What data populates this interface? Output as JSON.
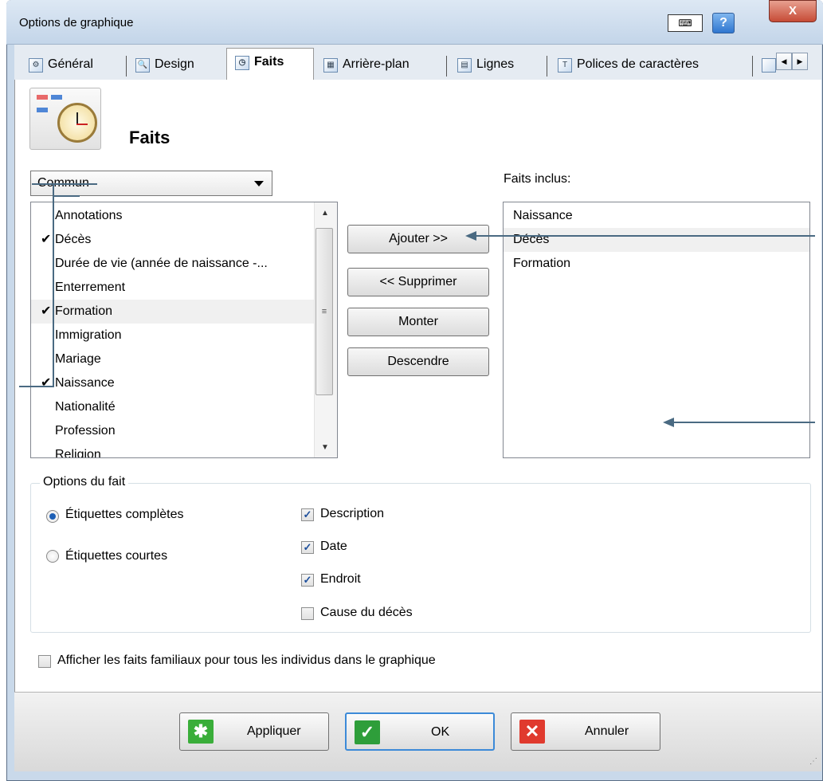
{
  "window": {
    "title": "Options de graphique",
    "help_label": "?",
    "close_label": "X",
    "keyboard_icon": "keyboard-icon"
  },
  "tabs": [
    {
      "label": "Général",
      "icon": "gear-doc-icon"
    },
    {
      "label": "Design",
      "icon": "magnifier-doc-icon"
    },
    {
      "label": "Faits",
      "icon": "clock-doc-icon",
      "active": true
    },
    {
      "label": "Arrière-plan",
      "icon": "background-icon"
    },
    {
      "label": "Lignes",
      "icon": "lines-icon"
    },
    {
      "label": "Polices de caractères",
      "icon": "font-icon"
    }
  ],
  "page": {
    "heading": "Faits",
    "icon": "facts-clock-icon"
  },
  "category": {
    "selected": "Commun"
  },
  "available_facts": [
    {
      "label": "Annotations",
      "checked": false
    },
    {
      "label": "Décès",
      "checked": true
    },
    {
      "label": "Durée de vie (année de naissance -...",
      "checked": false
    },
    {
      "label": "Enterrement",
      "checked": false
    },
    {
      "label": "Formation",
      "checked": true,
      "highlighted": true
    },
    {
      "label": "Immigration",
      "checked": false
    },
    {
      "label": "Mariage",
      "checked": false
    },
    {
      "label": "Naissance",
      "checked": true
    },
    {
      "label": "Nationalité",
      "checked": false
    },
    {
      "label": "Profession",
      "checked": false
    },
    {
      "label": "Religion",
      "checked": false
    }
  ],
  "actions": {
    "add": "Ajouter >>",
    "remove": "<< Supprimer",
    "up": "Monter",
    "down": "Descendre"
  },
  "included": {
    "label": "Faits inclus:",
    "items": [
      "Naissance",
      "Décès",
      "Formation"
    ],
    "highlighted_index": 1
  },
  "fact_options": {
    "legend": "Options du fait",
    "radios": [
      {
        "label": "Étiquettes complètes",
        "selected": true
      },
      {
        "label": "Étiquettes courtes",
        "selected": false
      }
    ],
    "checkboxes": [
      {
        "label": "Description",
        "checked": true
      },
      {
        "label": "Date",
        "checked": true
      },
      {
        "label": "Endroit",
        "checked": true
      },
      {
        "label": "Cause du décès",
        "checked": false
      }
    ]
  },
  "family_facts": {
    "label": "Afficher les faits familiaux pour tous les individus dans le graphique",
    "checked": false
  },
  "footer": {
    "apply": "Appliquer",
    "ok": "OK",
    "cancel": "Annuler"
  },
  "colors": {
    "accent": "#1d5fb5",
    "annotation_line": "#4a6a82",
    "apply_icon": "#3aae3a",
    "ok_icon": "#2e9e3a",
    "cancel_icon": "#e03a2e"
  }
}
